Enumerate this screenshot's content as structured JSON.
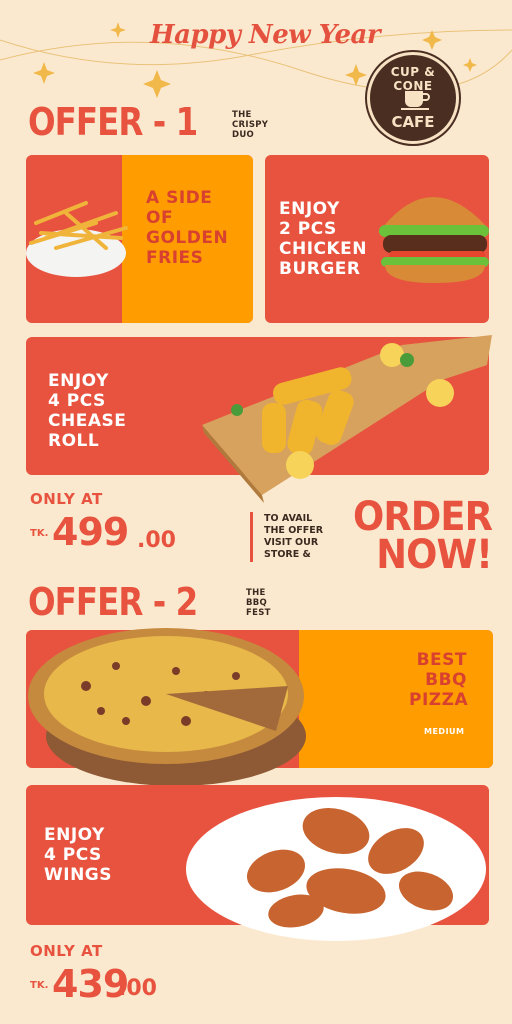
{
  "header": {
    "greeting": "Happy New Year",
    "logo_top": "CUP & CONE",
    "logo_bottom": "CAFE"
  },
  "offer1": {
    "title": "OFFER - 1",
    "subtitle": "THE\nCRISPY\nDUO",
    "items": [
      {
        "label": "A SIDE\nOF\nGOLDEN\nFRIES",
        "image": "fries-icon"
      },
      {
        "label": "ENJOY\n2 PCS\nCHICKEN\nBURGER",
        "image": "burger-icon"
      },
      {
        "label": "ENJOY\n4 PCS\nCHEASE\nROLL",
        "image": "cheese-roll-icon"
      }
    ],
    "price_label": "ONLY AT",
    "currency": "TK.",
    "price_whole": "499",
    "price_decimal": ".00"
  },
  "order_cta": {
    "avail_text": "TO AVAIL\nTHE OFFER\nVISIT OUR\nSTORE &",
    "order_text": "ORDER\nNOW!"
  },
  "offer2": {
    "title": "OFFER - 2",
    "subtitle": "THE\nBBQ\nFEST",
    "items": [
      {
        "label": "BEST\nBBQ\nPIZZA",
        "note": "MEDIUM",
        "image": "pizza-icon"
      },
      {
        "label": "ENJOY\n4 PCS\nWINGS",
        "image": "wings-icon"
      }
    ],
    "price_label": "ONLY AT",
    "currency": "TK.",
    "price_whole": "439",
    "price_decimal": ".00"
  },
  "colors": {
    "background": "#fbe9cf",
    "red": "#e8533f",
    "orange": "#ff9d00",
    "brown": "#4a2e22"
  }
}
